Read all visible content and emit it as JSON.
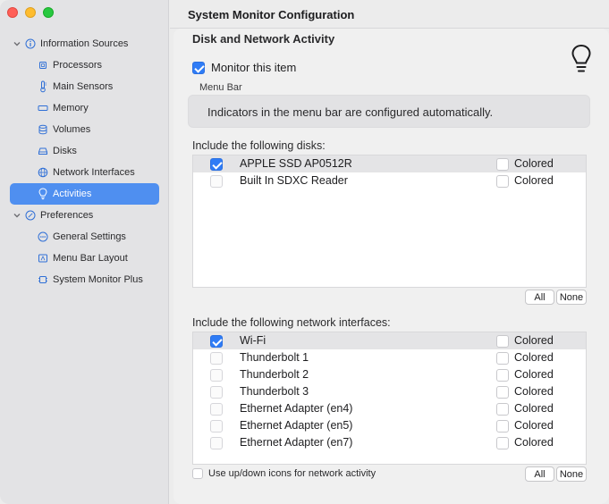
{
  "window": {
    "title": "System Monitor Configuration"
  },
  "sidebar": {
    "groups": [
      {
        "label": "Information Sources",
        "icon": "info-circle-icon",
        "items": [
          {
            "label": "Processors",
            "icon": "chip-icon"
          },
          {
            "label": "Main Sensors",
            "icon": "thermometer-icon"
          },
          {
            "label": "Memory",
            "icon": "memory-icon"
          },
          {
            "label": "Volumes",
            "icon": "database-icon"
          },
          {
            "label": "Disks",
            "icon": "disk-icon"
          },
          {
            "label": "Network Interfaces",
            "icon": "globe-icon"
          },
          {
            "label": "Activities",
            "icon": "lightbulb-icon",
            "selected": true
          }
        ]
      },
      {
        "label": "Preferences",
        "icon": "slash-circle-icon",
        "items": [
          {
            "label": "General Settings",
            "icon": "ellipsis-circle-icon"
          },
          {
            "label": "Menu Bar Layout",
            "icon": "menubar-icon"
          },
          {
            "label": "System Monitor Plus",
            "icon": "cpu-plus-icon"
          }
        ]
      }
    ]
  },
  "main": {
    "section_title": "Disk and Network Activity",
    "monitor_label": "Monitor this item",
    "monitor_checked": true,
    "menu_bar_label": "Menu Bar",
    "menu_bar_info": "Indicators in the menu bar are configured automatically.",
    "disks_label": "Include the following disks:",
    "disks": [
      {
        "name": "APPLE SSD AP0512R",
        "checked": true,
        "colored": false
      },
      {
        "name": "Built In SDXC Reader",
        "checked": false,
        "colored": false
      }
    ],
    "network_label": "Include the following network interfaces:",
    "interfaces": [
      {
        "name": "Wi-Fi",
        "checked": true,
        "colored": false
      },
      {
        "name": "Thunderbolt 1",
        "checked": false,
        "colored": false
      },
      {
        "name": "Thunderbolt 2",
        "checked": false,
        "colored": false
      },
      {
        "name": "Thunderbolt 3",
        "checked": false,
        "colored": false
      },
      {
        "name": "Ethernet Adapter (en4)",
        "checked": false,
        "colored": false
      },
      {
        "name": "Ethernet Adapter (en5)",
        "checked": false,
        "colored": false
      },
      {
        "name": "Ethernet Adapter (en7)",
        "checked": false,
        "colored": false
      }
    ],
    "colored_label": "Colored",
    "all_label": "All",
    "none_label": "None",
    "updown_label": "Use up/down icons for network activity",
    "updown_checked": false
  },
  "colors": {
    "accent": "#2f7cf6",
    "selection": "#4f8ff0"
  }
}
